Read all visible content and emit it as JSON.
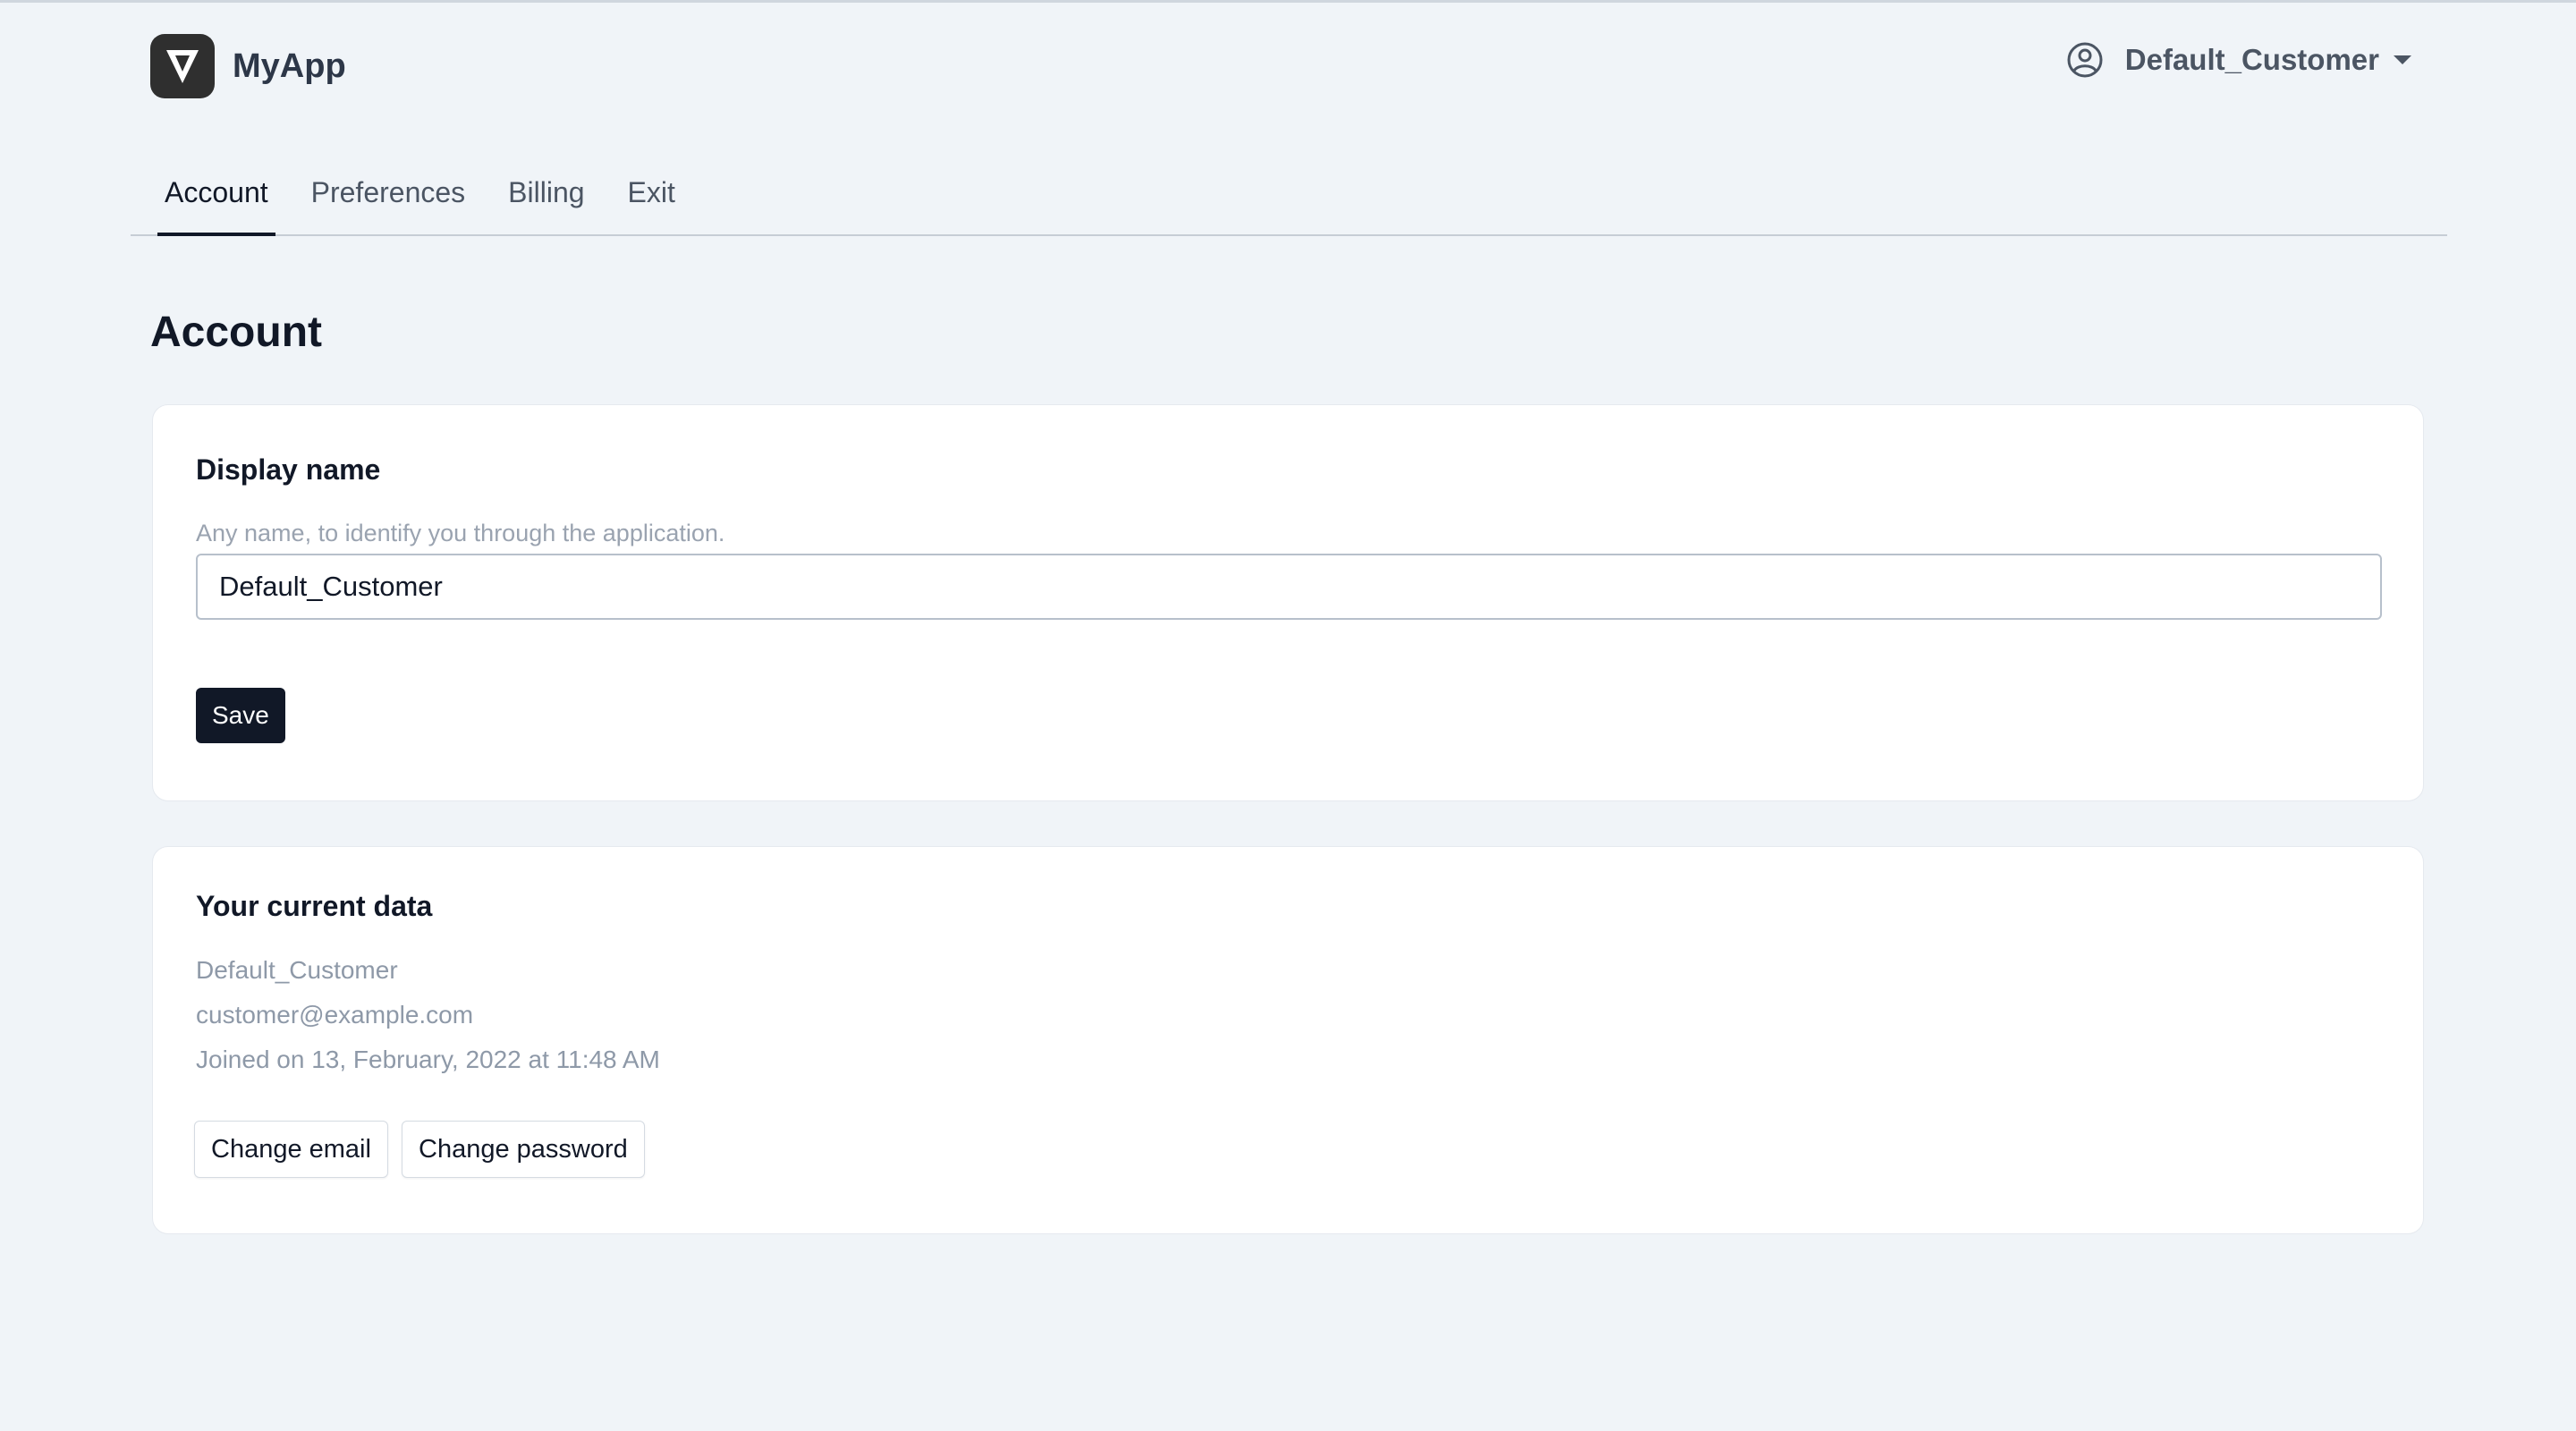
{
  "app": {
    "name": "MyApp"
  },
  "user_menu": {
    "username": "Default_Customer"
  },
  "tabs": [
    {
      "label": "Account",
      "active": true
    },
    {
      "label": "Preferences",
      "active": false
    },
    {
      "label": "Billing",
      "active": false
    },
    {
      "label": "Exit",
      "active": false
    }
  ],
  "page": {
    "title": "Account"
  },
  "display_name_card": {
    "title": "Display name",
    "hint": "Any name, to identify you through the application.",
    "input_value": "Default_Customer",
    "save_label": "Save"
  },
  "current_data_card": {
    "title": "Your current data",
    "name": "Default_Customer",
    "email": "customer@example.com",
    "joined": "Joined on 13, February, 2022 at 11:48 AM",
    "change_email_label": "Change email",
    "change_password_label": "Change password"
  },
  "colors": {
    "accent": "#111827",
    "background": "#f0f4f8",
    "muted_text": "#9aa3b0"
  },
  "icons": {
    "logo": "app-logo-icon",
    "user": "user-circle-icon",
    "caret": "caret-down-icon"
  }
}
